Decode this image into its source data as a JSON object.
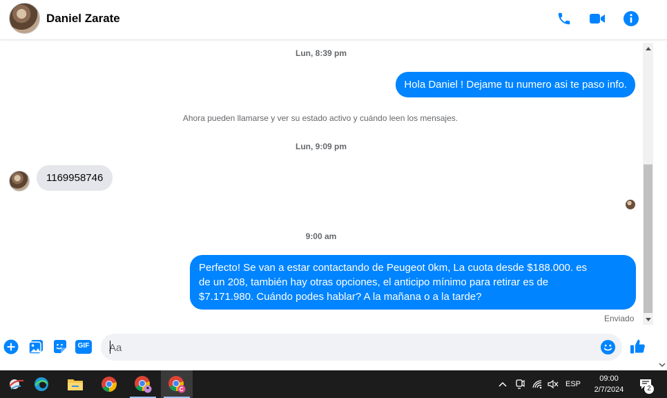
{
  "header": {
    "contact_name": "Daniel Zarate",
    "icons": [
      "phone-icon",
      "video-icon",
      "info-icon"
    ],
    "accent": "#0084ff"
  },
  "chat": {
    "ts1": "Lun, 8:39 pm",
    "msg_out_1": "Hola Daniel ! Dejame tu numero  asi te paso info.",
    "system_note": "Ahora pueden llamarse y ver su estado activo y cuándo leen los mensajes.",
    "ts2": "Lun, 9:09 pm",
    "msg_in_1": "1169958746",
    "ts3": "9:00 am",
    "msg_out_2_lines": [
      "Perfecto!  Se van a estar contactando de Peugeot 0km, La cuota desde $188.000. es",
      "de un 208, también hay otras opciones, el anticipo mínimo para retirar es de",
      "$7.171.980. Cuándo podes hablar? A la mañana o a la tarde?"
    ],
    "sent_status": "Enviado"
  },
  "composer": {
    "placeholder": "Aa",
    "icons": [
      "add-icon",
      "image-icon",
      "sticker-icon",
      "gif-icon",
      "emoji-icon",
      "like-icon"
    ],
    "gif_label": "GIF"
  },
  "taskbar": {
    "language": "ESP",
    "time": "09:00",
    "date": "2/7/2024",
    "notification_count": "2",
    "background": "#1c1c1c"
  }
}
